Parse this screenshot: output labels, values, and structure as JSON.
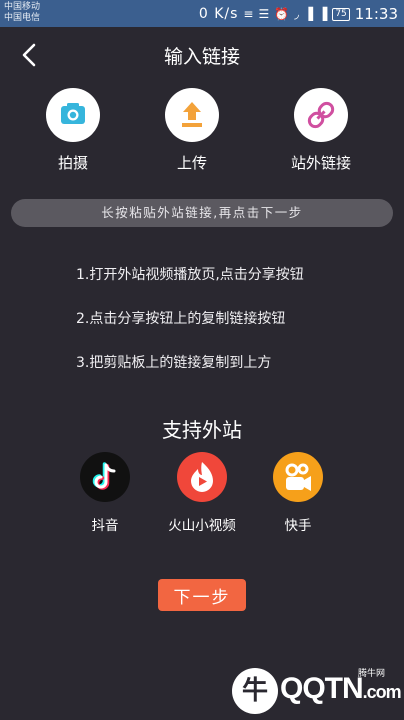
{
  "status_bar": {
    "carrier_1": "中国移动",
    "carrier_2": "中国电信",
    "net_speed": "0 K/s",
    "battery": "75",
    "time": "11:33"
  },
  "header": {
    "title": "输入链接"
  },
  "actions": [
    {
      "label": "拍摄",
      "icon": "camera-icon",
      "color": "#36b5dc"
    },
    {
      "label": "上传",
      "icon": "upload-icon",
      "color": "#f3a23a"
    },
    {
      "label": "站外链接",
      "icon": "link-icon",
      "color": "#d04fa0"
    }
  ],
  "hint": "长按粘贴外站链接,再点击下一步",
  "steps": [
    "1.打开外站视频播放页,点击分享按钮",
    "2.点击分享按钮上的复制链接按钮",
    "3.把剪贴板上的链接复制到上方"
  ],
  "support": {
    "title": "支持外站",
    "sites": [
      {
        "label": "抖音",
        "icon": "douyin-logo-icon",
        "color": "#111111"
      },
      {
        "label": "火山小视频",
        "icon": "huoshan-logo-icon",
        "color": "#f0473a"
      },
      {
        "label": "快手",
        "icon": "kuaishou-logo-icon",
        "color": "#f6a01a"
      }
    ]
  },
  "next_button": "下一步",
  "watermark": {
    "text": "QQTN",
    "sub": "腾牛网",
    "suffix": ".com"
  }
}
